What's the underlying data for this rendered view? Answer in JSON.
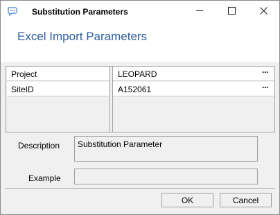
{
  "window": {
    "title": "Substitution Parameters",
    "app_icon": "chat-bubble-icon",
    "controls": {
      "minimize_icon": "minimize-icon",
      "maximize_icon": "maximize-icon",
      "close_icon": "close-icon"
    }
  },
  "header": {
    "title": "Excel Import Parameters",
    "title_color": "#2f5d9e"
  },
  "parameters": [
    {
      "name": "Project",
      "value": "LEOPARD",
      "browse_label": "···"
    },
    {
      "name": "SiteID",
      "value": "A152061",
      "browse_label": "···"
    }
  ],
  "description": {
    "label": "Description",
    "value": "Substitution Parameter"
  },
  "example": {
    "label": "Example",
    "value": ""
  },
  "buttons": {
    "ok_label": "OK",
    "cancel_label": "Cancel"
  }
}
